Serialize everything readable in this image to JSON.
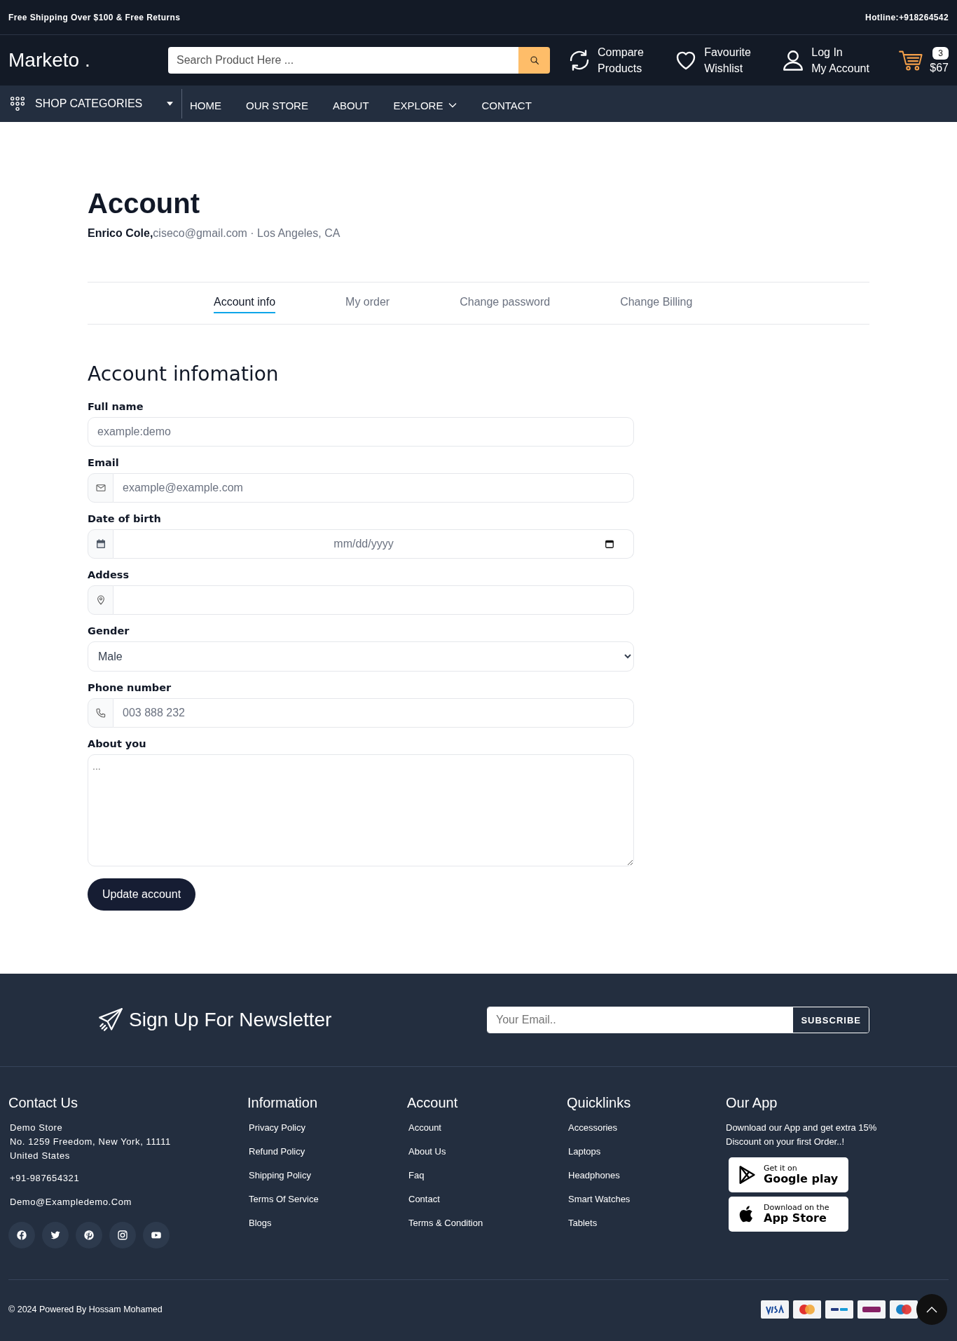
{
  "top_bar": {
    "promo": "Free Shipping Over $100 & Free Returns",
    "hotline": "Hotline:+918264542"
  },
  "header": {
    "logo": "Marketo .",
    "search": {
      "placeholder": "Search Product Here ..."
    },
    "actions": [
      {
        "kind": "compare",
        "lines": [
          "Compare",
          "Products"
        ]
      },
      {
        "kind": "wishlist",
        "lines": [
          "Favourite",
          "Wishlist"
        ]
      },
      {
        "kind": "account",
        "lines": [
          "Log In",
          "My Account"
        ]
      }
    ],
    "cart": {
      "count": "3",
      "total": "$67"
    }
  },
  "nav": {
    "categories": "SHOP CATEGORIES",
    "items": [
      {
        "label": "HOME",
        "dropdown": false
      },
      {
        "label": "OUR STORE",
        "dropdown": false
      },
      {
        "label": "ABOUT",
        "dropdown": false
      },
      {
        "label": "EXPLORE",
        "dropdown": true
      },
      {
        "label": "CONTACT",
        "dropdown": false
      }
    ]
  },
  "account": {
    "title": "Account",
    "meta": "**Enrico Cole,**ciseco@gmail.com · Los Angeles, CA"
  },
  "tabs": [
    {
      "label": "Account info",
      "selected": true
    },
    {
      "label": "My order",
      "selected": false
    },
    {
      "label": "Change password",
      "selected": false
    },
    {
      "label": "Change Billing",
      "selected": false
    }
  ],
  "form": {
    "title": "Account infomation",
    "fields": [
      {
        "label": "Full name",
        "kind": "text",
        "placeholder": "example:demo"
      },
      {
        "label": "Email",
        "kind": "email",
        "placeholder": "example@example.com"
      },
      {
        "label": "Date of birth",
        "kind": "date",
        "placeholder": "mm/dd/yyyy"
      },
      {
        "label": "Addess",
        "kind": "address"
      },
      {
        "label": "Gender",
        "kind": "select",
        "value": "Male"
      },
      {
        "label": "Phone number",
        "kind": "phone",
        "placeholder": "003 888 232"
      },
      {
        "label": "About you",
        "kind": "textarea",
        "placeholder": "..."
      }
    ],
    "submit": "Update account"
  },
  "newsletter": {
    "title": "Sign Up For Newsletter",
    "placeholder": "Your Email..",
    "button": "SUBSCRIBE"
  },
  "footer": {
    "contact": {
      "title": "Contact Us",
      "address": [
        "Demo Store",
        "No. 1259 Freedom, New York, 11111",
        "United States"
      ],
      "phone": "+91-987654321",
      "email": "Demo@Exampledemo.Com"
    },
    "columns": [
      {
        "title": "Information",
        "links": [
          "Privacy Policy",
          "Refund Policy",
          "Shipping Policy",
          "Terms Of Service",
          "Blogs"
        ]
      },
      {
        "title": "Account",
        "links": [
          "Account",
          "About Us",
          "Faq",
          "Contact",
          "Terms & Condition"
        ]
      },
      {
        "title": "Quicklinks",
        "links": [
          "Accessories",
          "Laptops",
          "Headphones",
          "Smart Watches",
          "Tablets"
        ]
      }
    ],
    "app": {
      "title": "Our App",
      "text": "Download our App and get extra 15% Discount on your first Order..!",
      "badges": [
        {
          "kind": "google",
          "small": "Get it on",
          "big": "Google play"
        },
        {
          "kind": "apple",
          "small": "Download on the",
          "big": "App Store"
        }
      ]
    },
    "copyright": "© 2024  Powered By Hossam Mohamed"
  }
}
